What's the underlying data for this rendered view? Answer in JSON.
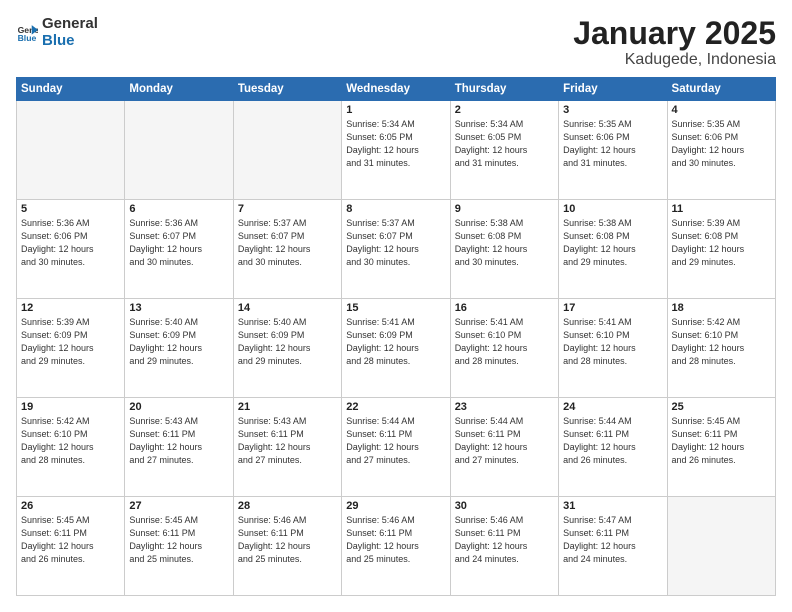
{
  "header": {
    "logo_general": "General",
    "logo_blue": "Blue",
    "month": "January 2025",
    "location": "Kadugede, Indonesia"
  },
  "weekdays": [
    "Sunday",
    "Monday",
    "Tuesday",
    "Wednesday",
    "Thursday",
    "Friday",
    "Saturday"
  ],
  "weeks": [
    [
      {
        "day": "",
        "info": ""
      },
      {
        "day": "",
        "info": ""
      },
      {
        "day": "",
        "info": ""
      },
      {
        "day": "1",
        "info": "Sunrise: 5:34 AM\nSunset: 6:05 PM\nDaylight: 12 hours\nand 31 minutes."
      },
      {
        "day": "2",
        "info": "Sunrise: 5:34 AM\nSunset: 6:05 PM\nDaylight: 12 hours\nand 31 minutes."
      },
      {
        "day": "3",
        "info": "Sunrise: 5:35 AM\nSunset: 6:06 PM\nDaylight: 12 hours\nand 31 minutes."
      },
      {
        "day": "4",
        "info": "Sunrise: 5:35 AM\nSunset: 6:06 PM\nDaylight: 12 hours\nand 30 minutes."
      }
    ],
    [
      {
        "day": "5",
        "info": "Sunrise: 5:36 AM\nSunset: 6:06 PM\nDaylight: 12 hours\nand 30 minutes."
      },
      {
        "day": "6",
        "info": "Sunrise: 5:36 AM\nSunset: 6:07 PM\nDaylight: 12 hours\nand 30 minutes."
      },
      {
        "day": "7",
        "info": "Sunrise: 5:37 AM\nSunset: 6:07 PM\nDaylight: 12 hours\nand 30 minutes."
      },
      {
        "day": "8",
        "info": "Sunrise: 5:37 AM\nSunset: 6:07 PM\nDaylight: 12 hours\nand 30 minutes."
      },
      {
        "day": "9",
        "info": "Sunrise: 5:38 AM\nSunset: 6:08 PM\nDaylight: 12 hours\nand 30 minutes."
      },
      {
        "day": "10",
        "info": "Sunrise: 5:38 AM\nSunset: 6:08 PM\nDaylight: 12 hours\nand 29 minutes."
      },
      {
        "day": "11",
        "info": "Sunrise: 5:39 AM\nSunset: 6:08 PM\nDaylight: 12 hours\nand 29 minutes."
      }
    ],
    [
      {
        "day": "12",
        "info": "Sunrise: 5:39 AM\nSunset: 6:09 PM\nDaylight: 12 hours\nand 29 minutes."
      },
      {
        "day": "13",
        "info": "Sunrise: 5:40 AM\nSunset: 6:09 PM\nDaylight: 12 hours\nand 29 minutes."
      },
      {
        "day": "14",
        "info": "Sunrise: 5:40 AM\nSunset: 6:09 PM\nDaylight: 12 hours\nand 29 minutes."
      },
      {
        "day": "15",
        "info": "Sunrise: 5:41 AM\nSunset: 6:09 PM\nDaylight: 12 hours\nand 28 minutes."
      },
      {
        "day": "16",
        "info": "Sunrise: 5:41 AM\nSunset: 6:10 PM\nDaylight: 12 hours\nand 28 minutes."
      },
      {
        "day": "17",
        "info": "Sunrise: 5:41 AM\nSunset: 6:10 PM\nDaylight: 12 hours\nand 28 minutes."
      },
      {
        "day": "18",
        "info": "Sunrise: 5:42 AM\nSunset: 6:10 PM\nDaylight: 12 hours\nand 28 minutes."
      }
    ],
    [
      {
        "day": "19",
        "info": "Sunrise: 5:42 AM\nSunset: 6:10 PM\nDaylight: 12 hours\nand 28 minutes."
      },
      {
        "day": "20",
        "info": "Sunrise: 5:43 AM\nSunset: 6:11 PM\nDaylight: 12 hours\nand 27 minutes."
      },
      {
        "day": "21",
        "info": "Sunrise: 5:43 AM\nSunset: 6:11 PM\nDaylight: 12 hours\nand 27 minutes."
      },
      {
        "day": "22",
        "info": "Sunrise: 5:44 AM\nSunset: 6:11 PM\nDaylight: 12 hours\nand 27 minutes."
      },
      {
        "day": "23",
        "info": "Sunrise: 5:44 AM\nSunset: 6:11 PM\nDaylight: 12 hours\nand 27 minutes."
      },
      {
        "day": "24",
        "info": "Sunrise: 5:44 AM\nSunset: 6:11 PM\nDaylight: 12 hours\nand 26 minutes."
      },
      {
        "day": "25",
        "info": "Sunrise: 5:45 AM\nSunset: 6:11 PM\nDaylight: 12 hours\nand 26 minutes."
      }
    ],
    [
      {
        "day": "26",
        "info": "Sunrise: 5:45 AM\nSunset: 6:11 PM\nDaylight: 12 hours\nand 26 minutes."
      },
      {
        "day": "27",
        "info": "Sunrise: 5:45 AM\nSunset: 6:11 PM\nDaylight: 12 hours\nand 25 minutes."
      },
      {
        "day": "28",
        "info": "Sunrise: 5:46 AM\nSunset: 6:11 PM\nDaylight: 12 hours\nand 25 minutes."
      },
      {
        "day": "29",
        "info": "Sunrise: 5:46 AM\nSunset: 6:11 PM\nDaylight: 12 hours\nand 25 minutes."
      },
      {
        "day": "30",
        "info": "Sunrise: 5:46 AM\nSunset: 6:11 PM\nDaylight: 12 hours\nand 24 minutes."
      },
      {
        "day": "31",
        "info": "Sunrise: 5:47 AM\nSunset: 6:11 PM\nDaylight: 12 hours\nand 24 minutes."
      },
      {
        "day": "",
        "info": ""
      }
    ]
  ]
}
